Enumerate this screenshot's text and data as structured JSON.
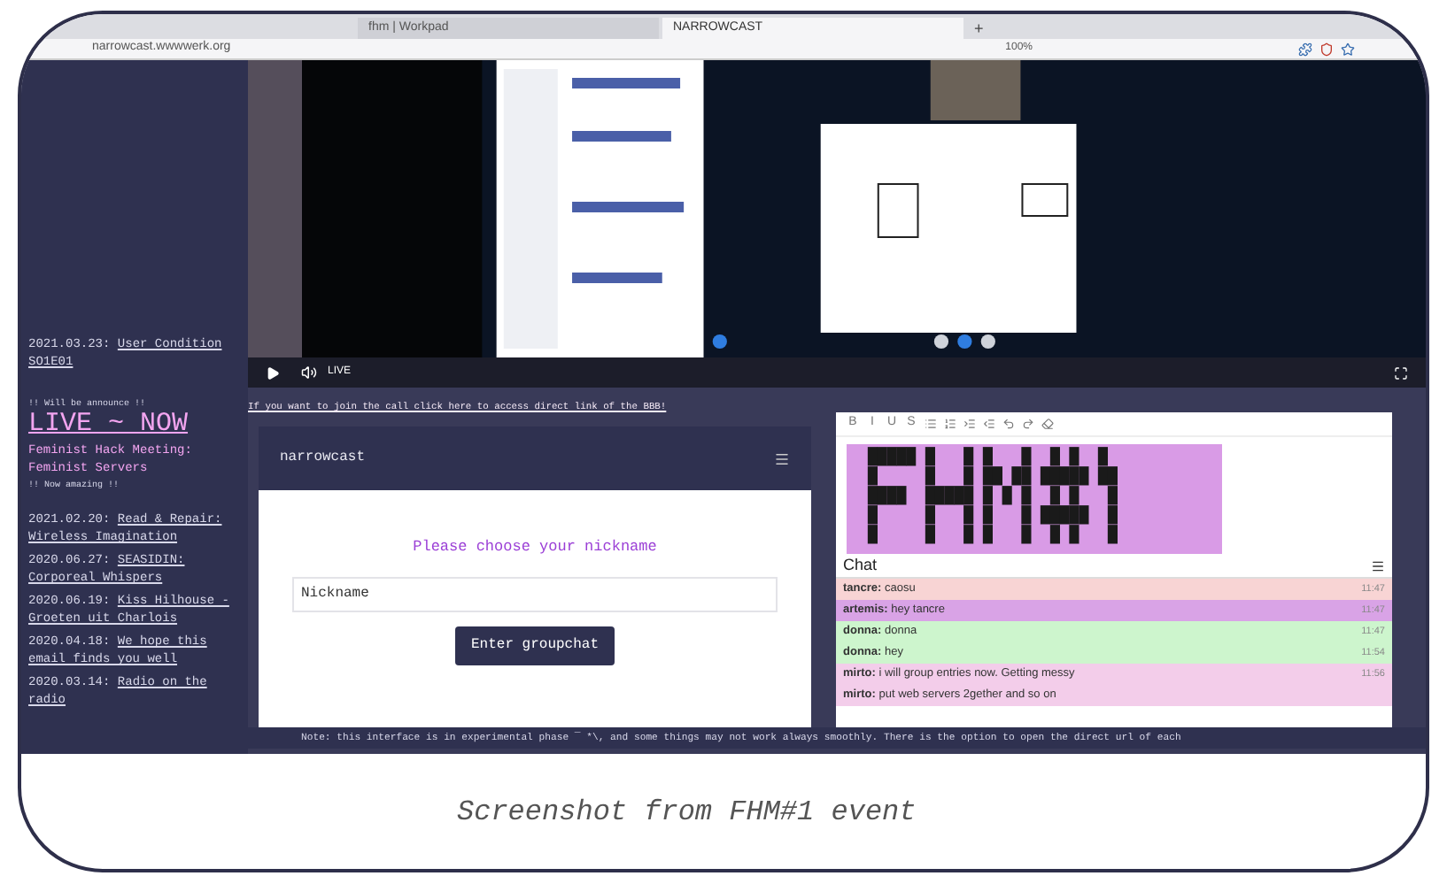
{
  "browser": {
    "tabs": [
      {
        "label": "fhm | Workpad",
        "selected": false
      },
      {
        "label": "NARROWCAST",
        "selected": true
      }
    ],
    "new_tab": "+",
    "url": "narrowcast.wwwwerk.org",
    "zoom": "100%"
  },
  "sidebar": {
    "current": {
      "date": "2021.03.23:",
      "title": "User Condition SO1E01"
    },
    "announce": "!! Will be announce !!",
    "live": "LIVE ~ NOW",
    "live_event": "Feminist Hack Meeting: Feminist Servers",
    "now": "!! Now amazing !!",
    "archive": [
      {
        "date": "2021.02.20:",
        "title": "Read & Repair: Wireless Imagination"
      },
      {
        "date": "2020.06.27:",
        "title": "SEASIDIN: Corporeal Whispers"
      },
      {
        "date": "2020.06.19:",
        "title": "Kiss Hilhouse - Groeten uit Charlois"
      },
      {
        "date": "2020.04.18:",
        "title": "We hope this email finds you well"
      },
      {
        "date": "2020.03.14:",
        "title": "Radio on the radio"
      }
    ]
  },
  "player": {
    "live": "LIVE"
  },
  "call_link": "If you want to join the call click here to access direct link of the BBB!",
  "narrowcast": {
    "title": "narrowcast",
    "prompt": "Please choose your nickname",
    "nickname": {
      "placeholder": "Nickname"
    },
    "button": "Enter groupchat"
  },
  "pad": {
    "toolbar": [
      {
        "kind": "text",
        "label": "B"
      },
      {
        "kind": "text",
        "label": "I"
      },
      {
        "kind": "text",
        "label": "U"
      },
      {
        "kind": "text",
        "label": "S"
      },
      {
        "kind": "icon"
      },
      {
        "kind": "icon"
      },
      {
        "kind": "icon"
      },
      {
        "kind": "icon"
      },
      {
        "kind": "icon"
      },
      {
        "kind": "icon"
      },
      {
        "kind": "icon"
      }
    ],
    "art_lines": [
      "█████ █   █ █   █  █ █  █",
      "█     █   █ ██ ██ █████ ██",
      "████  █████ █ █ █  █ █   █",
      "█     █   █ █   █ █████  █",
      "█     █   █ █   █  █ █   █"
    ]
  },
  "chat": {
    "title": "Chat",
    "messages": [
      {
        "user": "tancre:",
        "text": "caosu",
        "time": "11:47",
        "color": "#f8d4d4"
      },
      {
        "user": "artemis:",
        "text": "hey tancre",
        "time": "11:47",
        "color": "#d9a3e6"
      },
      {
        "user": "donna:",
        "text": "donna",
        "time": "11:47",
        "color": "#cdf5cd"
      },
      {
        "user": "donna:",
        "text": "hey",
        "time": "11:54",
        "color": "#cdf5cd"
      },
      {
        "user": "mirto:",
        "text": "i will group entries now. Getting messy",
        "time": "11:56",
        "color": "#f3cdea"
      },
      {
        "user": "mirto:",
        "text": "put web servers 2gether and so on",
        "color": "#f3cdea"
      }
    ]
  },
  "note": "Note: this interface is in experimental phase ¯ *\\, and some things may not work always smoothly. There is the option to open the direct url of each",
  "caption": "Screenshot from FHM#1 event"
}
